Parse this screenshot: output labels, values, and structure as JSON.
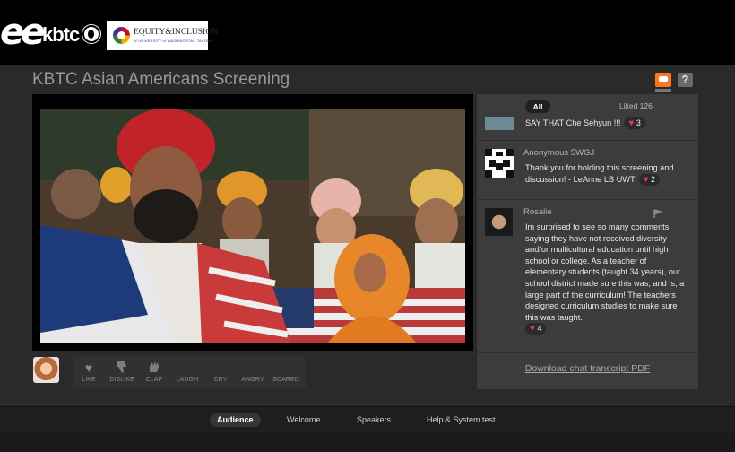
{
  "header": {
    "brand_mark": "ee",
    "brand_name": "kbtc",
    "equity_logo_title": "EQUITY&INCLUSION",
    "equity_logo_sub": "W UNIVERSITY of WASHINGTON | TACOMA"
  },
  "page": {
    "title": "KBTC Asian Americans Screening"
  },
  "reactions": [
    {
      "id": "like",
      "label": "LIKE",
      "icon": "heart-icon"
    },
    {
      "id": "dislike",
      "label": "DISLIKE",
      "icon": "thumbs-down-icon"
    },
    {
      "id": "clap",
      "label": "CLAP",
      "icon": "clap-icon"
    },
    {
      "id": "laugh",
      "label": "LAUGH",
      "icon": "laugh-icon"
    },
    {
      "id": "cry",
      "label": "CRY",
      "icon": "cry-icon"
    },
    {
      "id": "angry",
      "label": "ANGRY",
      "icon": "angry-icon"
    },
    {
      "id": "scared",
      "label": "SCARED",
      "icon": "scared-icon"
    }
  ],
  "chat": {
    "tab_all": "All",
    "tab_liked": "Liked 126",
    "messages": [
      {
        "name": "",
        "text": "SAY THAT Che Sehyun !!!",
        "likes": "3"
      },
      {
        "name": "Anonymous 5WGJ",
        "text": "Thank you for holding this screening and discussion! - LeAnne LB UWT",
        "likes": "2"
      },
      {
        "name": "Rosalie",
        "text": "Im surprised to see so many comments saying they have not received diversity and/or multicultural education until high school or college. As a teacher of elementary students (taught 34 years), our school district made sure this was, and is, a large part of the curriculum! The teachers designed curriculum studies to make sure this was taught.",
        "likes": "4"
      }
    ],
    "download_label": "Download chat transcript PDF"
  },
  "nav": {
    "tabs": [
      "Audience",
      "Welcome",
      "Speakers",
      "Help & System test"
    ],
    "active": "Audience"
  },
  "colors": {
    "accent": "#f57a23",
    "like_heart": "#e0394a",
    "background": "#2a2a2a"
  }
}
